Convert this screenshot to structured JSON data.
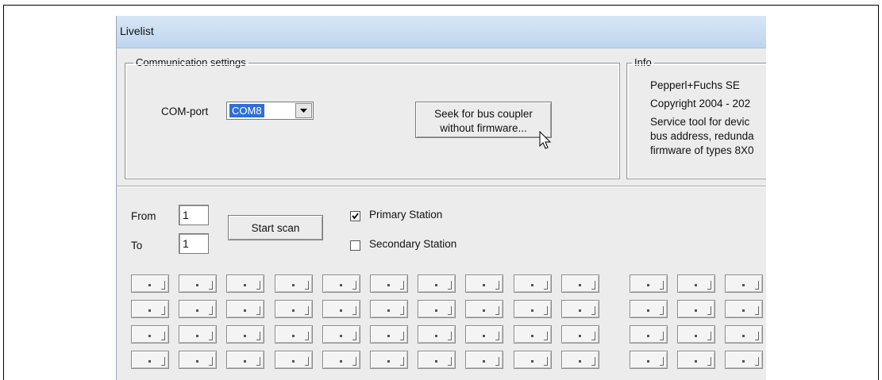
{
  "window": {
    "title": "Livelist"
  },
  "communication": {
    "legend": "Communication settings",
    "com_label": "COM-port",
    "com_value": "COM8",
    "seek_line1": "Seek for bus coupler",
    "seek_line2": "without firmware..."
  },
  "info": {
    "legend": "Info",
    "lines": [
      "Pepperl+Fuchs SE",
      "Copyright 2004 - 202",
      "Service tool for devic",
      "bus address, redunda",
      "firmware of types 8X0"
    ]
  },
  "scan": {
    "from_label": "From",
    "from_value": "1",
    "to_label": "To",
    "to_value": "1",
    "start_label": "Start scan",
    "primary_label": "Primary Station",
    "primary_checked": true,
    "secondary_label": "Secondary Station",
    "secondary_checked": false
  },
  "station_grid": {
    "rows": 4,
    "left_columns": 10,
    "right_columns": 3
  },
  "colors": {
    "selection": "#2e6fd8",
    "titlebar": "#c7daf0",
    "window_bg": "#ececec"
  }
}
